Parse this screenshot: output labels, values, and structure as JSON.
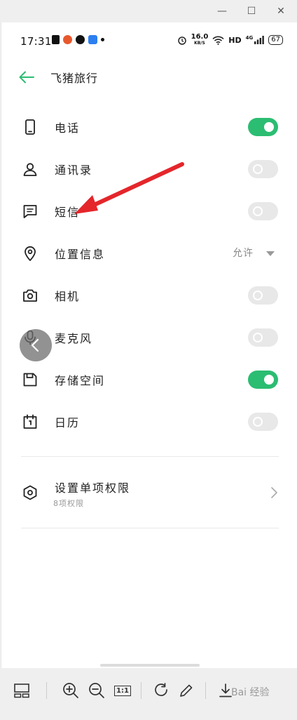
{
  "window_controls": {
    "minimize": "—",
    "maximize": "☐",
    "close": "✕"
  },
  "status_bar": {
    "time": "17:31",
    "net_speed": "16.0",
    "net_unit": "KB/S",
    "hd": "HD",
    "network": "4G",
    "battery": "67",
    "app_icon_colors": [
      "#111111",
      "#e8582d",
      "#111111",
      "#2d7ff0"
    ]
  },
  "header": {
    "back_icon": "arrow-left-icon",
    "title": "飞猪旅行",
    "accent_color": "#2bbd72"
  },
  "permissions": [
    {
      "label": "电话",
      "icon": "phone-icon",
      "control": "toggle",
      "enabled": true
    },
    {
      "label": "通讯录",
      "icon": "contacts-icon",
      "control": "toggle",
      "enabled": false
    },
    {
      "label": "短信",
      "icon": "message-icon",
      "control": "toggle",
      "enabled": false
    },
    {
      "label": "位置信息",
      "icon": "location-icon",
      "control": "select",
      "value": "允许"
    },
    {
      "label": "相机",
      "icon": "camera-icon",
      "control": "toggle",
      "enabled": false
    },
    {
      "label": "麦克风",
      "icon": "microphone-icon",
      "control": "toggle",
      "enabled": false
    },
    {
      "label": "存储空间",
      "icon": "storage-icon",
      "control": "toggle",
      "enabled": true
    },
    {
      "label": "日历",
      "icon": "calendar-icon",
      "control": "toggle",
      "enabled": false
    }
  ],
  "single_permissions": {
    "title": "设置单项权限",
    "subtitle": "8项权限",
    "icon": "hexagon-settings-icon"
  },
  "toolbar": {
    "ratio_label": "1:1",
    "watermark": "Bai 经验"
  }
}
